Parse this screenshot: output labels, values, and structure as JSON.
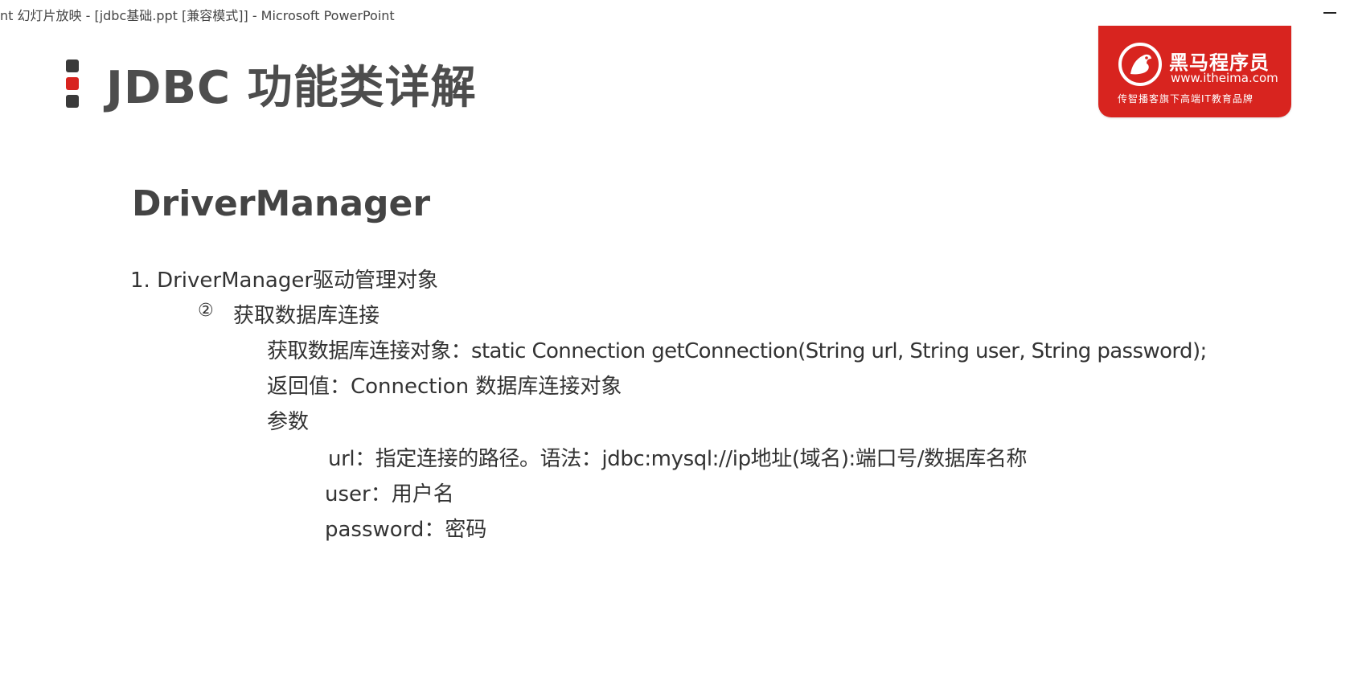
{
  "window": {
    "title": "nt 幻灯片放映 - [jdbc基础.ppt [兼容模式]] - Microsoft PowerPoint"
  },
  "slide": {
    "title": "JDBC 功能类详解",
    "marker_colors": [
      "#3a3a3a",
      "#d8241f",
      "#3a3a3a"
    ],
    "logo": {
      "name": "黑马程序员",
      "url": "www.itheima.com",
      "slogan": "传智播客旗下高端IT教育品牌",
      "background": "#d8241f"
    },
    "section_heading": "DriverManager",
    "item1": "1. DriverManager驱动管理对象",
    "sub_marker": "②",
    "sub_heading": "获取数据库连接",
    "method_line": "获取数据库连接对象：static Connection getConnection(String url, String user, String password);",
    "return_line": "返回值：Connection 数据库连接对象",
    "params_label": "参数",
    "param_url": "url：指定连接的路径。语法：jdbc:mysql://ip地址(域名):端口号/数据库名称",
    "param_user": "user：用户名",
    "param_password": "password：密码"
  }
}
